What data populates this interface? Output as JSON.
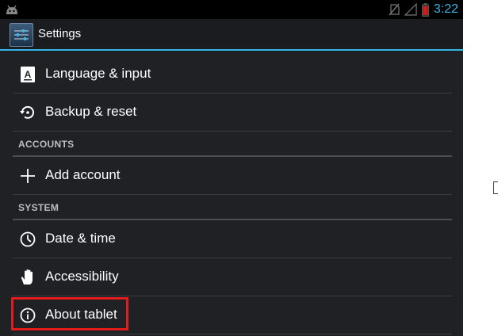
{
  "status_bar": {
    "time": "3:22",
    "icons": [
      "android-icon",
      "no-sim-icon",
      "signal-icon",
      "battery-low-icon"
    ],
    "accent_color": "#33b5e5"
  },
  "action_bar": {
    "title": "Settings",
    "icon": "settings-app-icon"
  },
  "list": {
    "items": [
      {
        "label": "Language & input",
        "icon": "language-icon"
      },
      {
        "label": "Backup & reset",
        "icon": "backup-reset-icon"
      }
    ],
    "accounts_header": "ACCOUNTS",
    "accounts_items": [
      {
        "label": "Add account",
        "icon": "plus-icon"
      }
    ],
    "system_header": "SYSTEM",
    "system_items": [
      {
        "label": "Date & time",
        "icon": "clock-icon"
      },
      {
        "label": "Accessibility",
        "icon": "hand-icon"
      },
      {
        "label": "About tablet",
        "icon": "info-icon",
        "highlighted": true
      }
    ]
  },
  "highlight_color": "#e21b1b"
}
